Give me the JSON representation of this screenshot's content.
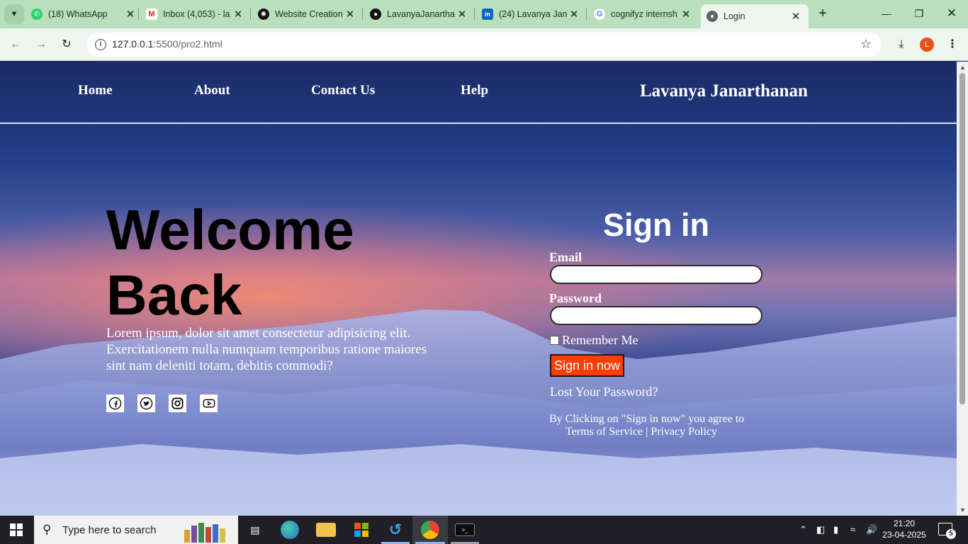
{
  "browser": {
    "tabs": [
      {
        "title": "(18) WhatsApp",
        "icon": "whatsapp-icon"
      },
      {
        "title": "Inbox (4,053) - la",
        "icon": "gmail-icon"
      },
      {
        "title": "Website Creation",
        "icon": "chatgpt-icon"
      },
      {
        "title": "LavanyaJanartha",
        "icon": "github-icon"
      },
      {
        "title": "(24) Lavanya Jan",
        "icon": "linkedin-icon"
      },
      {
        "title": "cognifyz internsh",
        "icon": "google-icon"
      },
      {
        "title": "Login",
        "icon": "globe-icon",
        "active": true
      }
    ],
    "url_host": "127.0.0.1",
    "url_path": ":5500/pro2.html",
    "profile_initial": "L"
  },
  "page": {
    "nav": {
      "home": "Home",
      "about": "About",
      "contact": "Contact Us",
      "help": "Help",
      "brand": "Lavanya Janarthanan"
    },
    "hero": {
      "title_line1": "Welcome",
      "title_line2": "Back",
      "text": "Lorem ipsum, dolor sit amet consectetur adipisicing elit. Exercitationem nulla numquam temporibus ratione maiores sint nam deleniti totam, debitis commodi?",
      "socials": [
        "facebook-icon",
        "twitter-icon",
        "instagram-icon",
        "youtube-icon"
      ]
    },
    "signin": {
      "title": "Sign in",
      "email_label": "Email",
      "email_value": "",
      "password_label": "Password",
      "password_value": "",
      "remember_label": "Remember Me",
      "remember_checked": false,
      "button": "Sign in now",
      "lost_password": "Lost Your Password?",
      "agree_line1": "By Clicking on \"Sign in now\" you agree to",
      "agree_line2": "Terms of Service | Privacy Policy"
    }
  },
  "taskbar": {
    "search_placeholder": "Type here to search",
    "time": "21:20",
    "date": "23-04-2025",
    "notification_count": "5"
  },
  "colors": {
    "tab_strip": "#b9dfbd",
    "toolbar": "#eef7ef",
    "signin_button": "#ff3d00",
    "taskbar": "#1f1f25"
  }
}
